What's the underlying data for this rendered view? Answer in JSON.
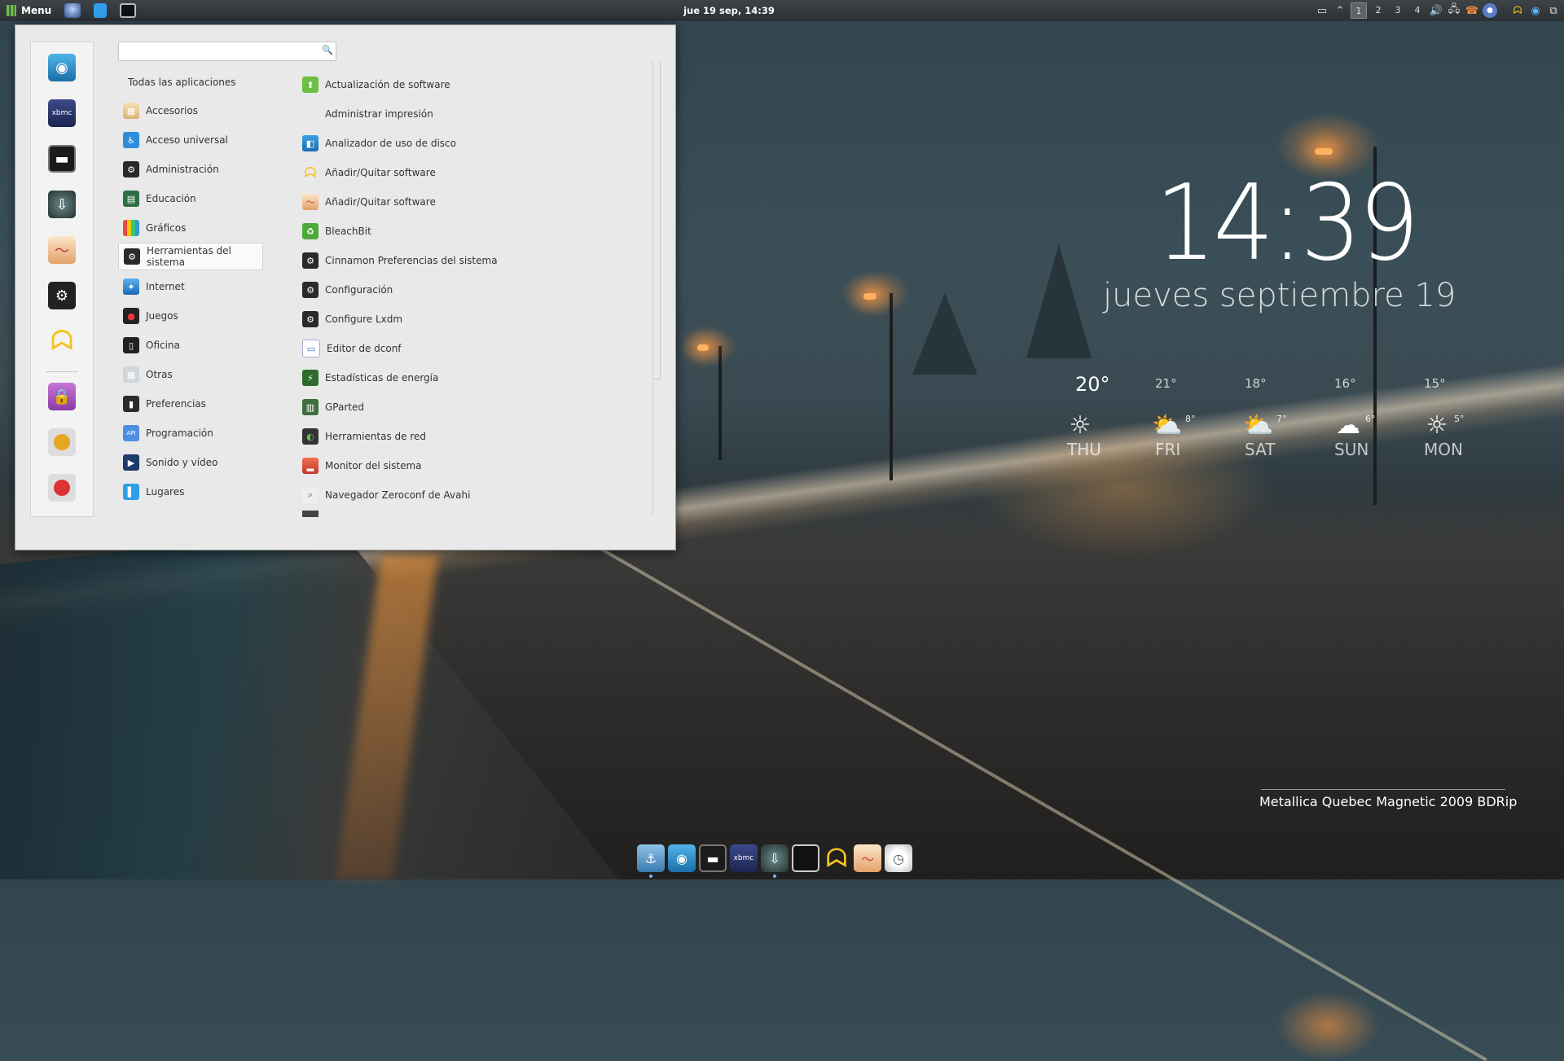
{
  "panel": {
    "menu_label": "Menu",
    "clock": "jue 19 sep, 14:39",
    "workspaces": [
      "1",
      "2",
      "3",
      "4"
    ],
    "active_workspace": "1"
  },
  "menu": {
    "search_value": "",
    "categories": [
      "Todas las aplicaciones",
      "Accesorios",
      "Acceso universal",
      "Administración",
      "Educación",
      "Gráficos",
      "Herramientas del sistema",
      "Internet",
      "Juegos",
      "Oficina",
      "Otras",
      "Preferencias",
      "Programación",
      "Sonido y vídeo",
      "Lugares"
    ],
    "selected_category": "Herramientas del sistema",
    "apps": [
      "Actualización de software",
      "Administrar impresión",
      "Analizador de uso de disco",
      "Añadir/Quitar software",
      "Añadir/Quitar software",
      "BleachBit",
      "Cinnamon Preferencias del sistema",
      "Configuración",
      "Configure Lxdm",
      "Editor de dconf",
      "Estadísticas de energía",
      "GParted",
      "Herramientas de red",
      "Monitor del sistema",
      "Navegador Zeroconf de Avahi"
    ]
  },
  "desklet": {
    "time": "14:39",
    "date": "jueves septiembre 19",
    "forecast": [
      {
        "day": "THU",
        "high": "20°",
        "low": "",
        "icon": "sun-icon"
      },
      {
        "day": "FRI",
        "high": "21°",
        "low": "8°",
        "icon": "partly-cloudy-icon"
      },
      {
        "day": "SAT",
        "high": "18°",
        "low": "7°",
        "icon": "partly-cloudy-icon"
      },
      {
        "day": "SUN",
        "high": "16°",
        "low": "6°",
        "icon": "rain-icon"
      },
      {
        "day": "MON",
        "high": "15°",
        "low": "5°",
        "icon": "sun-icon"
      }
    ]
  },
  "now_playing": "Metallica Quebec Magnetic 2009 BDRip",
  "colors": {
    "panel": "#2f3438",
    "menu_bg": "#e9e9e9",
    "accent_green": "#6cbe45"
  }
}
